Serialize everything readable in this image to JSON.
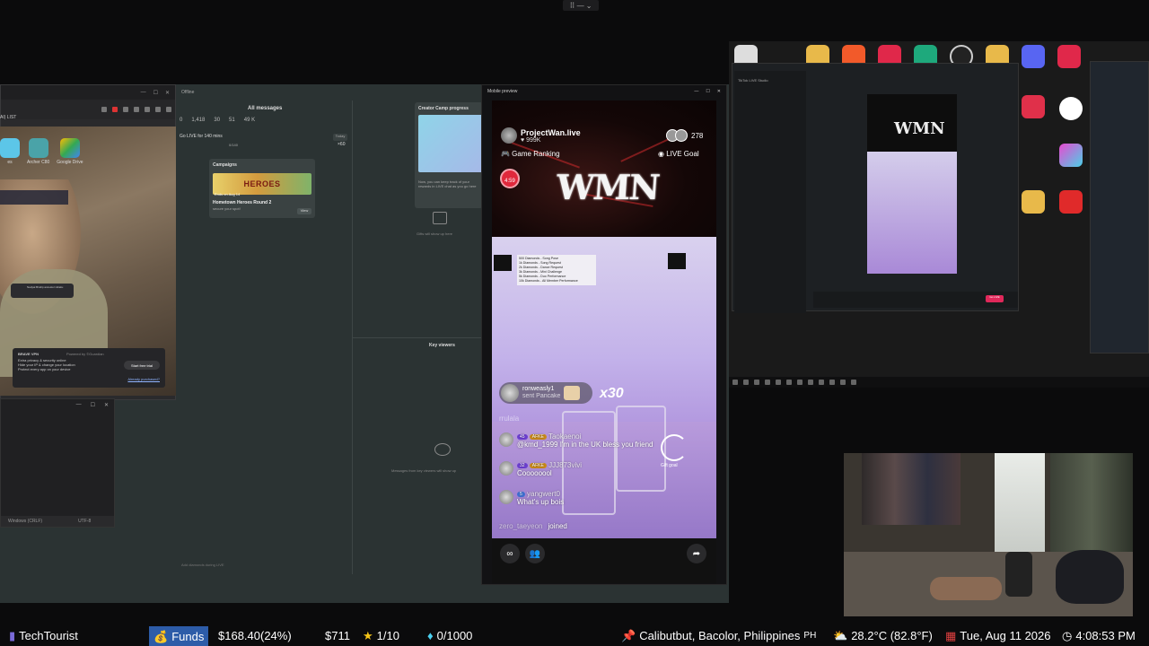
{
  "topctl": {
    "label": "⠿ — ⌄"
  },
  "browser": {
    "list_label": "AI) LIST",
    "apps": [
      {
        "label": "es"
      },
      {
        "label": "Archer C80"
      },
      {
        "label": "Google Drive"
      }
    ],
    "notif_text": "Nadyai Bindip ancestor Hiraku",
    "vpn": {
      "title": "BRAVE VPN",
      "powered": "Powered by ©Guardian",
      "lines": [
        "Extra privacy & security online",
        "Hide your IP & change your location",
        "Protect every app on your device"
      ],
      "trial_button": "Start free trial",
      "already": "Already purchased?"
    }
  },
  "notepad": {
    "encoding_line": "Windows (CRLF)",
    "charset": "UTF-8"
  },
  "studio": {
    "offline": "Offline",
    "all_messages": "All messages",
    "stats": [
      "0",
      "1,418",
      "30",
      "51",
      "49 K"
    ],
    "go_live": "Go LIVE for 140 mins",
    "progress": "0/140",
    "today": "Today",
    "multiplier": "×60",
    "campaigns": {
      "title": "Campaigns",
      "banner": "HEROES",
      "banner_sub": "Ends on Aug 14",
      "name": "Hometown Heroes Round 2",
      "sub": "secure your spot!",
      "view": "View"
    },
    "creator": {
      "title": "Creator Camp progress",
      "desc": "Now, you can keep track of your rewards in LIVE chat as you go here"
    },
    "gifts": "Gifts will show up here",
    "key_viewers": "Key viewers",
    "kv_msg": "Messages from key viewers will show up",
    "add_diamonds": "Add diamonds during LIVE"
  },
  "mobile": {
    "title": "Mobile preview",
    "controls": [
      "—",
      "☐",
      "✕"
    ],
    "host": {
      "name": "ProjectWan.live",
      "likes": "♥ 999K"
    },
    "viewers": "278",
    "game_ranking": "🎮 Game Ranking",
    "live_goal": "LIVE Goal",
    "timer": "4:59",
    "logo": "WMN",
    "menu_lines": [
      "500 Diamonds - Song Pose",
      "1k Diamonds - Song Request",
      "2k Diamonds - Dance Request",
      "3k Diamonds - Mini Challenge",
      "5k Diamonds - Duo Performance",
      "10k Diamonds - All Member Performance"
    ],
    "gift": {
      "user": "ronweasly1",
      "action": "sent Pancake",
      "count": "x30"
    },
    "sub_line": "rrulala",
    "chat": [
      {
        "badge": "45",
        "tag": "AFKE",
        "user": "Taokaenoi",
        "text": "@kmd_1999 I'm in the UK bless you friend"
      },
      {
        "badge": "32",
        "tag": "AFKE",
        "user": "JJJ873vivi",
        "text": "Coooooool"
      },
      {
        "badge": "5",
        "tag": "",
        "user": "yangwert0",
        "text": "What's up bois"
      }
    ],
    "joined": {
      "user": "zero_taeyeon",
      "text": "joined"
    },
    "goal_label": "Gift goal"
  },
  "desk": {
    "mini_title": "TikTok LIVE Studio",
    "mini_logo": "WMN",
    "go_live": "Go LIVE"
  },
  "statusbar": {
    "channel": "TechTourist",
    "funds_label": "Funds",
    "funds_value": "$168.40(24%)",
    "amount": "$711",
    "stars": "1/10",
    "diamonds": "0/1000",
    "location": "Calibutbut, Bacolor, Philippines",
    "country": "PH",
    "weather": "28.2°C (82.8°F)",
    "date": "Tue, Aug 11 2026",
    "time": "4:08:53 PM"
  }
}
